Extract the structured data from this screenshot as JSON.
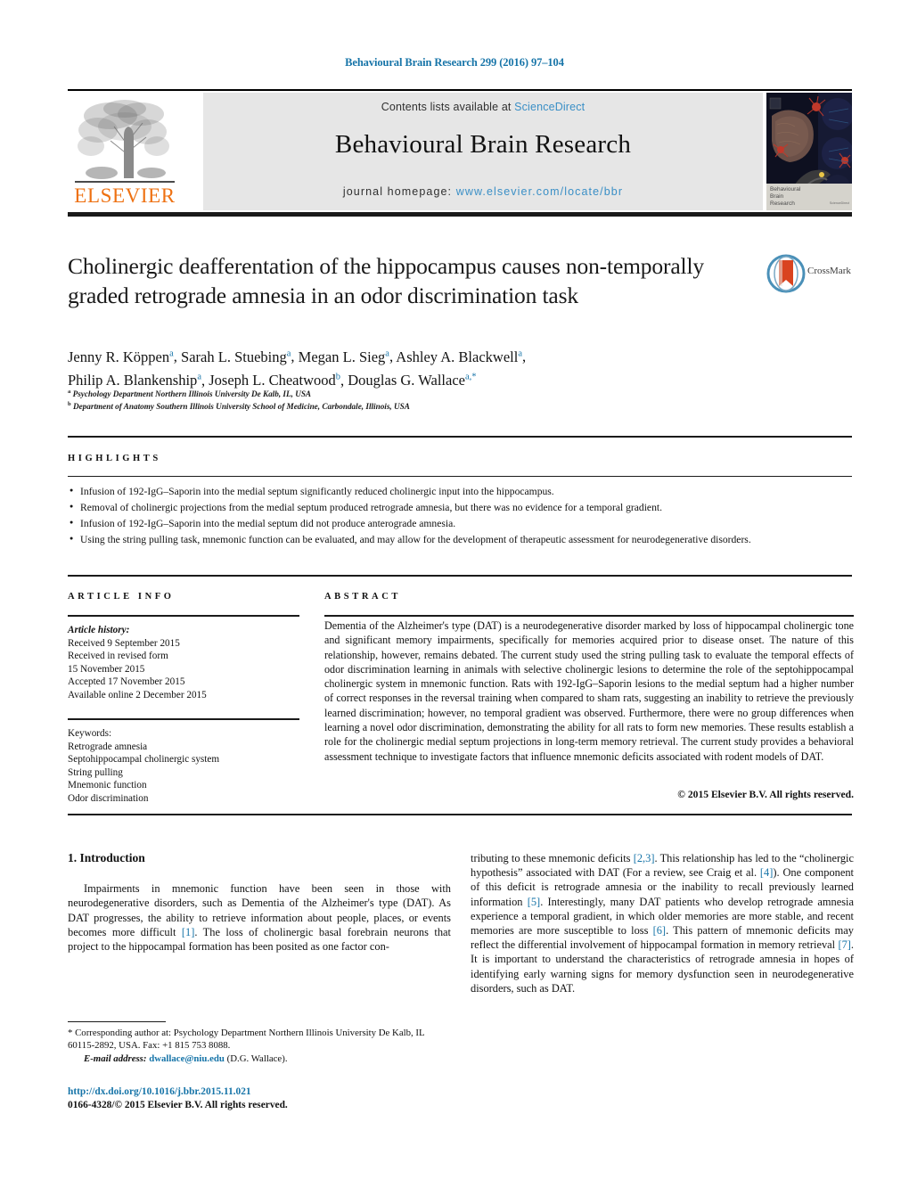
{
  "running_head": "Behavioural Brain Research 299 (2016) 97–104",
  "masthead": {
    "contents_prefix": "Contents lists available at ",
    "sciencedirect": "ScienceDirect",
    "journal_title": "Behavioural Brain Research",
    "homepage_prefix": "journal homepage: ",
    "homepage_url": "www.elsevier.com/locate/bbr",
    "publisher_wordmark": "ELSEVIER",
    "publisher_logo_icon": "elsevier-tree-icon",
    "cover_caption_line1": "Behavioural",
    "cover_caption_line2": "Brain",
    "cover_caption_line3": "Research",
    "cover_caption_tiny": "ScienceDirect"
  },
  "colors": {
    "link_blue": "#1674a8",
    "elsevier_orange": "#ee7112",
    "masthead_grey": "#e6e6e6",
    "sciencedirect_blue": "#3a8fc6"
  },
  "title": "Cholinergic deafferentation of the hippocampus causes non-temporally graded retrograde amnesia in an odor discrimination task",
  "crossmark": {
    "label": "CrossMark",
    "icon": "crossmark-logo-icon"
  },
  "authors_line1": "Jenny R. Köppen",
  "authors_html": "authors-with-superscripts",
  "authors": [
    {
      "name": "Jenny R. Köppen",
      "sup": "a"
    },
    {
      "name": "Sarah L. Stuebing",
      "sup": "a"
    },
    {
      "name": "Megan L. Sieg",
      "sup": "a"
    },
    {
      "name": "Ashley A. Blackwell",
      "sup": "a"
    },
    {
      "name": "Philip A. Blankenship",
      "sup": "a"
    },
    {
      "name": "Joseph L. Cheatwood",
      "sup": "b"
    },
    {
      "name": "Douglas G. Wallace",
      "sup": "a,*"
    }
  ],
  "affiliations": [
    {
      "marker": "a",
      "text": "Psychology Department Northern Illinois University De Kalb, IL, USA"
    },
    {
      "marker": "b",
      "text": "Department of Anatomy Southern Illinois University School of Medicine, Carbondale, Illinois, USA"
    }
  ],
  "highlights": {
    "label": "HIGHLIGHTS",
    "items": [
      "Infusion of 192-IgG–Saporin into the medial septum significantly reduced cholinergic input into the hippocampus.",
      "Removal of cholinergic projections from the medial septum produced retrograde amnesia, but there was no evidence for a temporal gradient.",
      "Infusion of 192-IgG–Saporin into the medial septum did not produce anterograde amnesia.",
      "Using the string pulling task, mnemonic function can be evaluated, and may allow for the development of therapeutic assessment for neurodegenerative disorders."
    ]
  },
  "article_info": {
    "label": "ARTICLE INFO",
    "history_label": "Article history:",
    "history": [
      "Received 9 September 2015",
      "Received in revised form",
      "15 November 2015",
      "Accepted 17 November 2015",
      "Available online 2 December 2015"
    ],
    "keywords_label": "Keywords:",
    "keywords": [
      "Retrograde amnesia",
      "Septohippocampal cholinergic system",
      "String pulling",
      "Mnemonic function",
      "Odor discrimination"
    ]
  },
  "abstract": {
    "label": "ABSTRACT",
    "text": "Dementia of the Alzheimer's type (DAT) is a neurodegenerative disorder marked by loss of hippocampal cholinergic tone and significant memory impairments, specifically for memories acquired prior to disease onset. The nature of this relationship, however, remains debated. The current study used the string pulling task to evaluate the temporal effects of odor discrimination learning in animals with selective cholinergic lesions to determine the role of the septohippocampal cholinergic system in mnemonic function. Rats with 192-IgG–Saporin lesions to the medial septum had a higher number of correct responses in the reversal training when compared to sham rats, suggesting an inability to retrieve the previously learned discrimination; however, no temporal gradient was observed. Furthermore, there were no group differences when learning a novel odor discrimination, demonstrating the ability for all rats to form new memories. These results establish a role for the cholinergic medial septum projections in long-term memory retrieval. The current study provides a behavioral assessment technique to investigate factors that influence mnemonic deficits associated with rodent models of DAT.",
    "copyright": "© 2015 Elsevier B.V. All rights reserved."
  },
  "introduction": {
    "heading": "1.  Introduction",
    "left_para_1": "Impairments in mnemonic function have been seen in those with neurodegenerative disorders, such as Dementia of the Alzheimer's type (DAT). As DAT progresses, the ability to retrieve information about people, places, or events becomes more difficult ",
    "left_ref_1": "[1]",
    "left_para_2": ". The loss of cholinergic basal forebrain neurons that project to the hippocampal formation has been posited as one factor con-",
    "right_para_1": "tributing to these mnemonic deficits ",
    "right_ref_1": "[2,3]",
    "right_para_2": ". This relationship has led to the “cholinergic hypothesis” associated with DAT (For a review, see Craig et al. ",
    "right_ref_2": "[4]",
    "right_para_3": "). One component of this deficit is retrograde amnesia or the inability to recall previously learned information ",
    "right_ref_3": "[5]",
    "right_para_4": ". Interestingly, many DAT patients who develop retrograde amnesia experience a temporal gradient, in which older memories are more stable, and recent memories are more susceptible to loss ",
    "right_ref_4": "[6]",
    "right_para_5": ". This pattern of mnemonic deficits may reflect the differential involvement of hippocampal formation in memory retrieval ",
    "right_ref_5": "[7]",
    "right_para_6": ". It is important to understand the characteristics of retrograde amnesia in hopes of identifying early warning signs for memory dysfunction seen in neurodegenerative disorders, such as DAT."
  },
  "footer": {
    "corresponding_marker": "*",
    "corresponding_text": " Corresponding author at: Psychology Department Northern Illinois University De Kalb, IL 60115-2892, USA. Fax: +1 815 753 8088.",
    "email_label": "E-mail address:",
    "email": "dwallace@niu.edu",
    "email_suffix": " (D.G. Wallace).",
    "doi": "http://dx.doi.org/10.1016/j.bbr.2015.11.021",
    "issn_line": "0166-4328/© 2015 Elsevier B.V. All rights reserved."
  }
}
